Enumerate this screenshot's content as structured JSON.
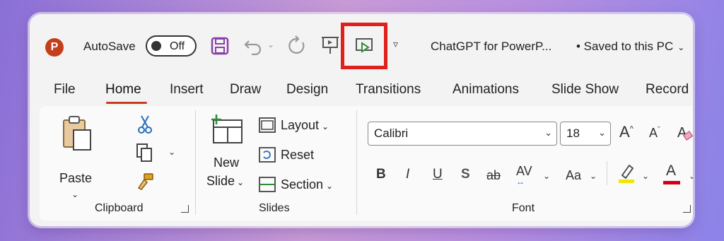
{
  "titlebar": {
    "autosave_label": "AutoSave",
    "autosave_state": "Off",
    "document_title": "ChatGPT for PowerP...",
    "save_status": "• Saved to this PC",
    "app_logo_letter": "P"
  },
  "tabs": [
    {
      "label": "File"
    },
    {
      "label": "Home"
    },
    {
      "label": "Insert"
    },
    {
      "label": "Draw"
    },
    {
      "label": "Design"
    },
    {
      "label": "Transitions"
    },
    {
      "label": "Animations"
    },
    {
      "label": "Slide Show"
    },
    {
      "label": "Record"
    }
  ],
  "active_tab": "Home",
  "clipboard": {
    "paste_label": "Paste",
    "group_label": "Clipboard"
  },
  "slides": {
    "new_slide_line1": "New",
    "new_slide_line2": "Slide",
    "layout_label": "Layout",
    "reset_label": "Reset",
    "section_label": "Section",
    "group_label": "Slides"
  },
  "font": {
    "font_name": "Calibri",
    "font_size": "18",
    "group_label": "Font",
    "bold": "B",
    "italic": "I",
    "underline": "U",
    "shadow": "S",
    "strike": "ab",
    "spacing": "AV",
    "change_case": "Aa",
    "grow": "A",
    "shrink": "A",
    "color_letter": "A"
  },
  "colors": {
    "accent": "#c43e1c",
    "highlight_box": "#e0201c",
    "highlight_bar": "#f2e600",
    "font_color_bar": "#d0021b"
  }
}
